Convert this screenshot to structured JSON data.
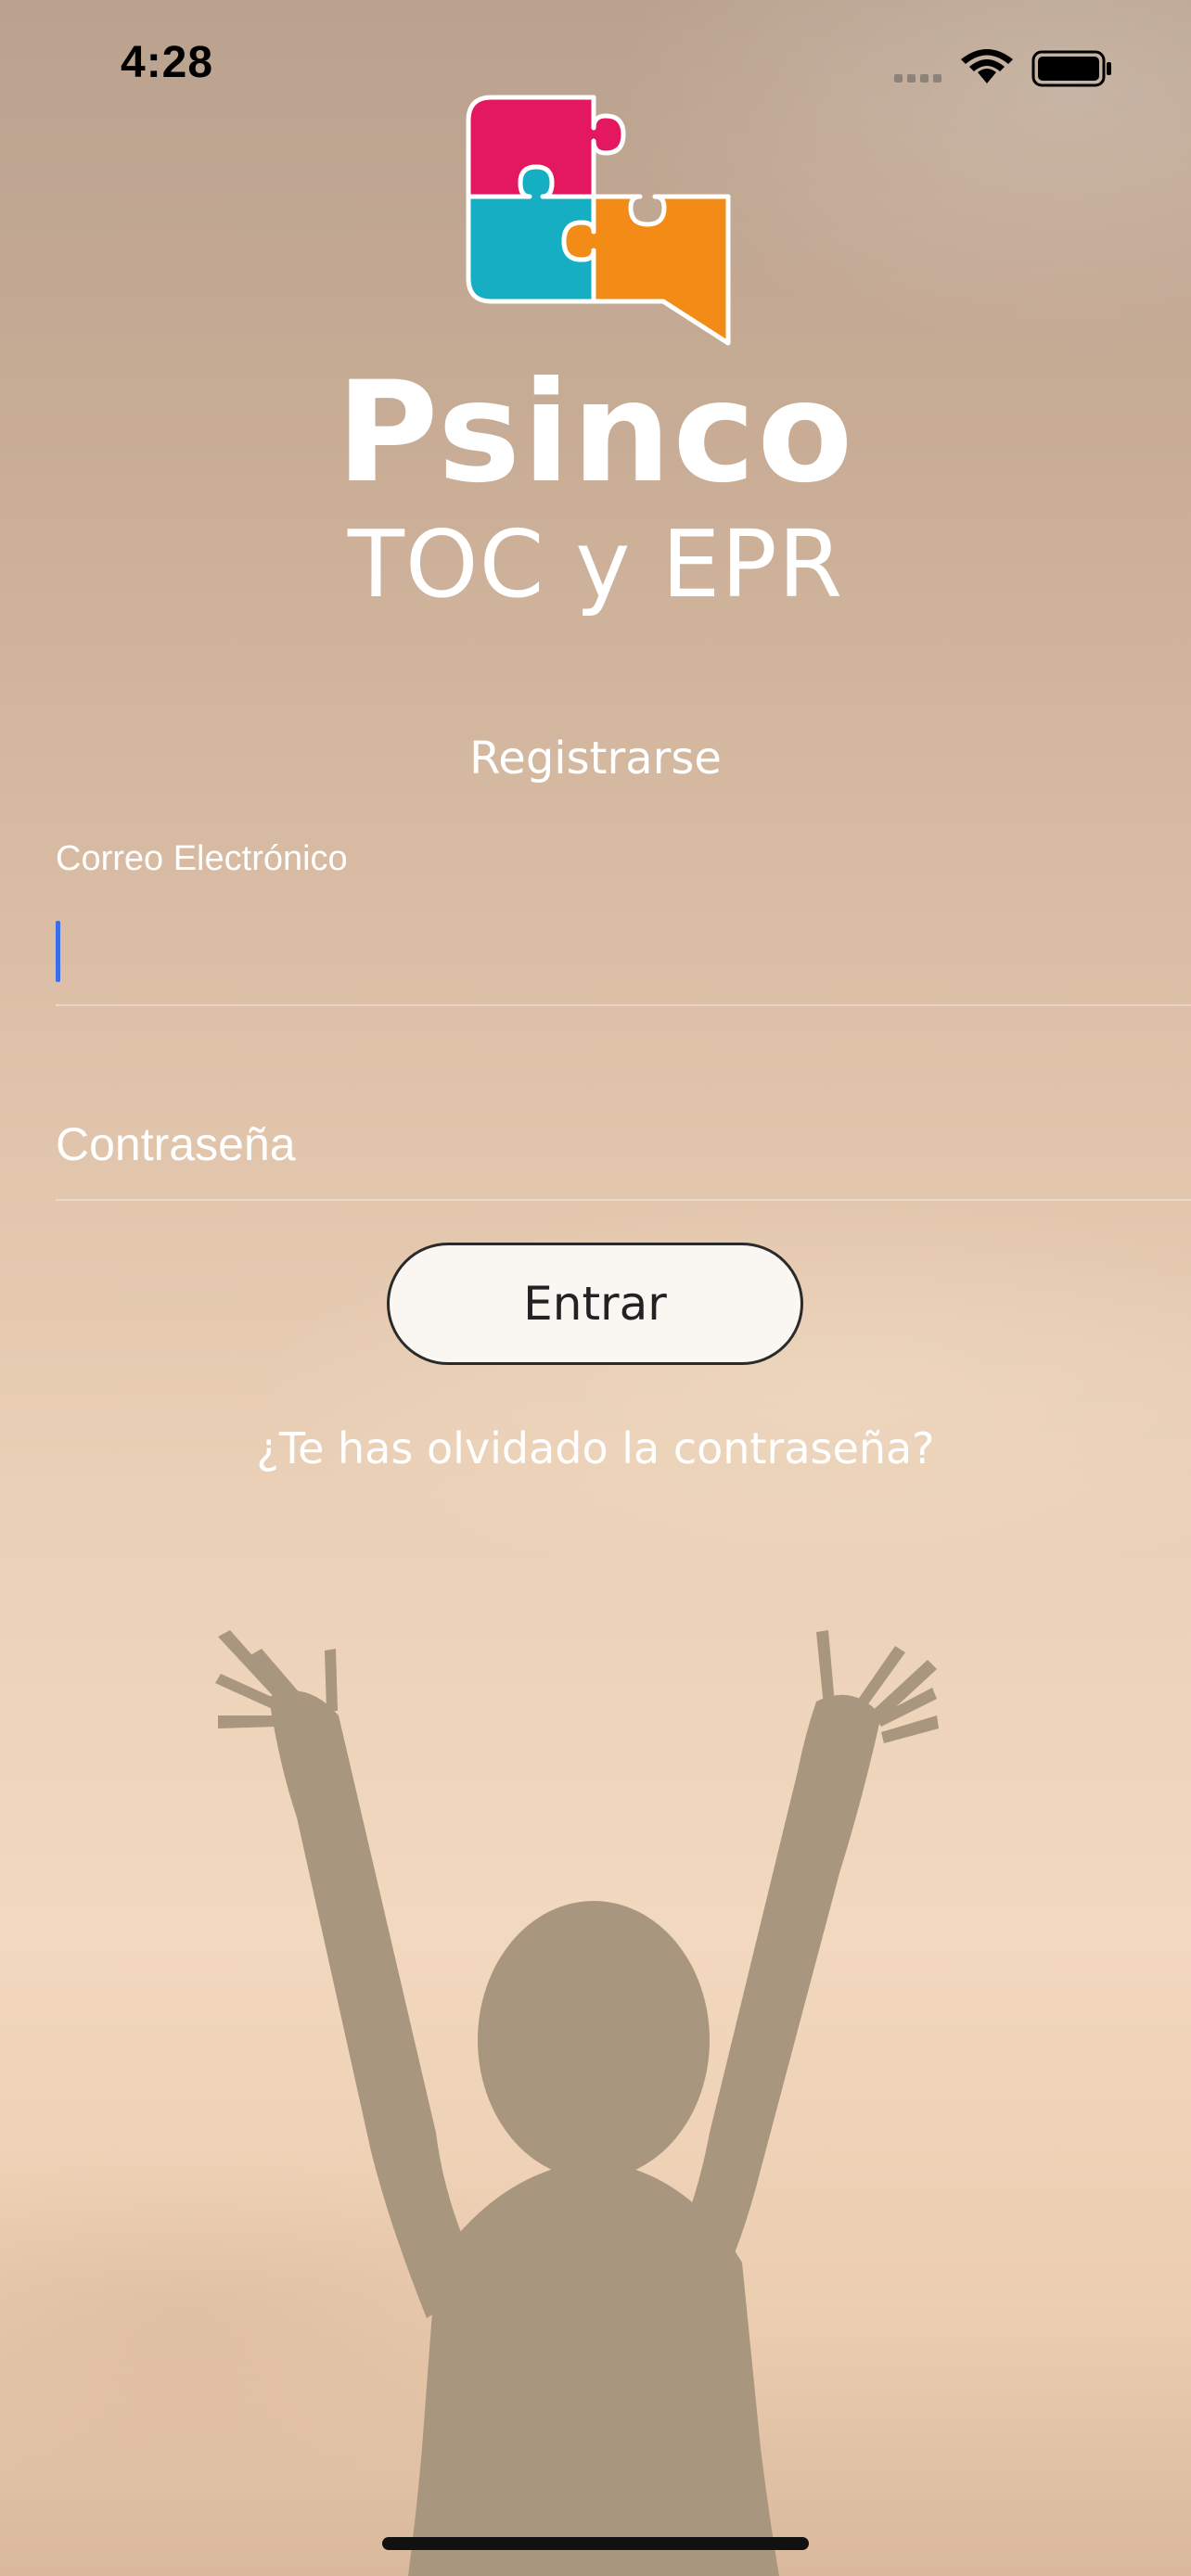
{
  "status_bar": {
    "time": "4:28",
    "icons": [
      "signal-icon",
      "wifi-icon",
      "battery-icon"
    ]
  },
  "brand": {
    "title": "Psinco",
    "subtitle": "TOC y EPR",
    "logo_colors": [
      "#e3185e",
      "#16aec2",
      "#f28c17"
    ]
  },
  "form": {
    "register_link": "Registrarse",
    "email_label": "Correo Electrónico",
    "email_value": "",
    "password_placeholder": "Contraseña",
    "submit_label": "Entrar",
    "forgot_password": "¿Te has olvidado la contraseña?"
  },
  "colors": {
    "caret": "#3a6ee8",
    "button_bg": "#faf6f1",
    "text": "#ffffff"
  }
}
